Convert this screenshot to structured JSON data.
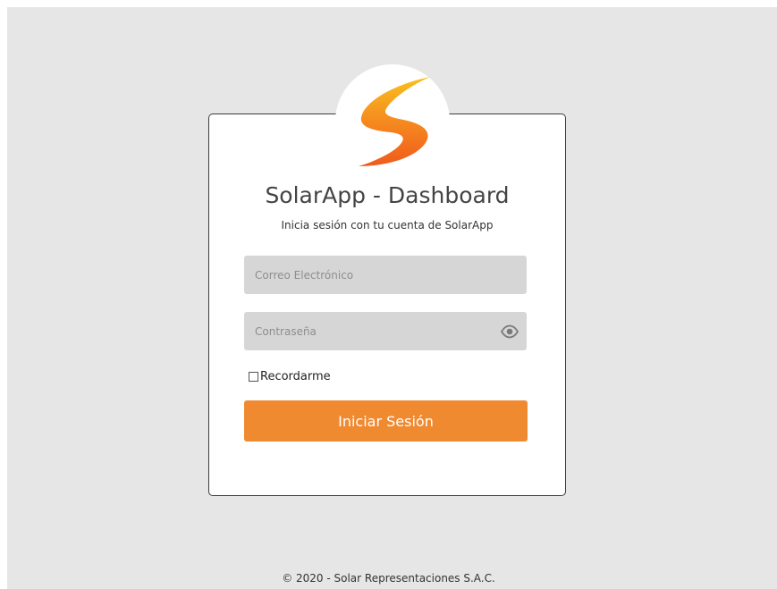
{
  "login": {
    "title": "SolarApp - Dashboard",
    "subtitle": "Inicia sesión con tu cuenta de SolarApp",
    "email_placeholder": "Correo Electrónico",
    "password_placeholder": "Contraseña",
    "remember_label": "Recordarme",
    "remember_checked": false,
    "submit_label": "Iniciar Sesión",
    "password_toggle_icon": "eye-icon"
  },
  "logo": {
    "icon": "solar-s-logo",
    "color_top": "#f7b21c",
    "color_bottom": "#f26b1d"
  },
  "footer": {
    "text": "© 2020 - Solar Representaciones S.A.C."
  },
  "colors": {
    "background": "#e6e6e6",
    "card": "#ffffff",
    "input_bg": "#d6d6d6",
    "accent": "#f08a31"
  }
}
